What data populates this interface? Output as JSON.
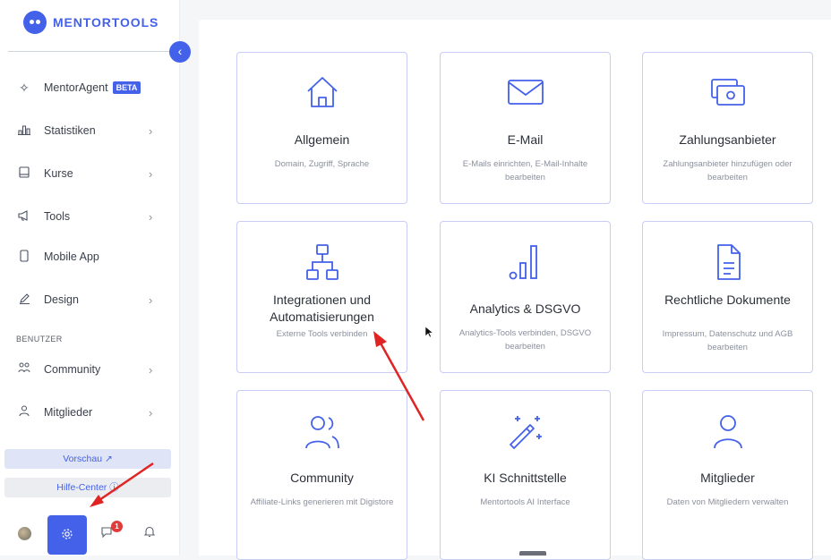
{
  "sidebar": {
    "logo_text": "MENTORTOOLS",
    "nav": [
      {
        "label": "MentorAgent",
        "badge": "BETA",
        "icon": "sparkle-icon"
      },
      {
        "label": "Statistiken",
        "icon": "bar-chart-icon",
        "chevron": true
      },
      {
        "label": "Kurse",
        "icon": "book-icon",
        "chevron": true
      },
      {
        "label": "Tools",
        "icon": "megaphone-icon",
        "chevron": true
      },
      {
        "label": "Mobile App",
        "icon": "phone-icon",
        "chevron": false
      },
      {
        "label": "Design",
        "icon": "pen-icon",
        "chevron": true
      }
    ],
    "section_label": "BENUTZER",
    "users_nav": [
      {
        "label": "Community",
        "icon": "people-icon",
        "chevron": true
      },
      {
        "label": "Mitglieder",
        "icon": "person-icon",
        "chevron": true
      }
    ],
    "preview_label": "Vorschau ↗",
    "help_label": "Hilfe-Center ⓘ",
    "notification_count": "1"
  },
  "cards": [
    {
      "title": "Allgemein",
      "desc": "Domain, Zugriff, Sprache",
      "icon": "house-icon"
    },
    {
      "title": "E-Mail",
      "desc": "E-Mails einrichten, E-Mail-Inhalte bearbeiten",
      "icon": "envelope-icon"
    },
    {
      "title": "Zahlungsanbieter",
      "desc": "Zahlungsanbieter hinzufügen oder bearbeiten",
      "icon": "money-icon"
    },
    {
      "title": "Integrationen und Automatisierungen",
      "desc": "Externe Tools verbinden",
      "icon": "network-icon"
    },
    {
      "title": "Analytics & DSGVO",
      "desc": "Analytics-Tools verbinden, DSGVO bearbeiten",
      "icon": "analytics-icon"
    },
    {
      "title": "Rechtliche Dokumente",
      "desc": "Impressum, Datenschutz und AGB bearbeiten",
      "icon": "document-icon"
    },
    {
      "title": "Community",
      "desc": "Affiliate-Links generieren mit Digistore",
      "icon": "community-icon"
    },
    {
      "title": "KI Schnittstelle",
      "desc": "Mentortools AI Interface",
      "icon": "magic-wand-icon"
    },
    {
      "title": "Mitglieder",
      "desc": "Daten von Mitgliedern verwalten",
      "icon": "member-icon"
    }
  ],
  "colors": {
    "accent": "#4461ea",
    "card_border": "#c7cdf4",
    "annotation": "#e02424"
  }
}
